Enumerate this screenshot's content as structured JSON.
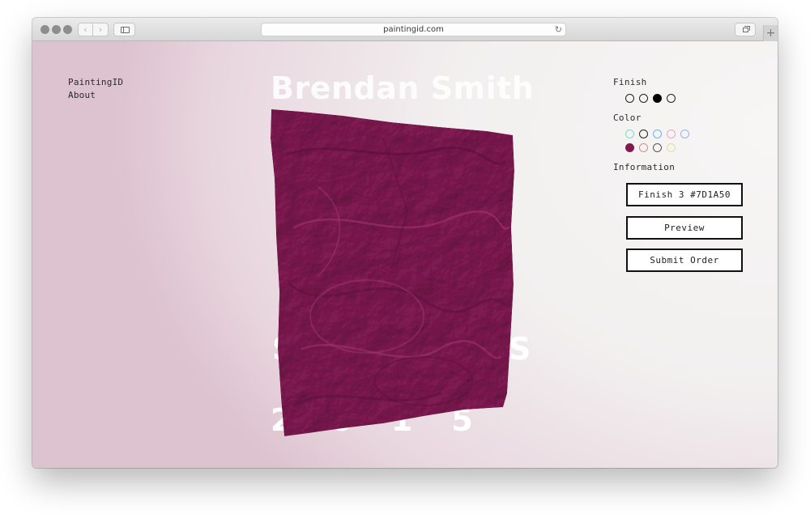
{
  "browser": {
    "url": "paintingid.com",
    "back_glyph": "‹",
    "forward_glyph": "›",
    "reload_glyph": "↻",
    "new_tab_glyph": "+"
  },
  "nav": {
    "items": [
      {
        "label": "PaintingID"
      },
      {
        "label": "About"
      }
    ]
  },
  "hero": {
    "artist": "Brendan Smith",
    "year": "2015",
    "partial_left": "S",
    "partial_right": "S"
  },
  "painting": {
    "color": "#7D1A50",
    "shadow_color": "#5a0f38",
    "highlight_color": "#a5386f"
  },
  "panel": {
    "finish_label": "Finish",
    "finish_options": [
      {
        "fill": "transparent",
        "border": "#222222",
        "selected": false
      },
      {
        "fill": "transparent",
        "border": "#222222",
        "selected": false
      },
      {
        "fill": "#000000",
        "border": "#000000",
        "selected": true
      },
      {
        "fill": "transparent",
        "border": "#222222",
        "selected": false
      }
    ],
    "color_label": "Color",
    "color_options_row1": [
      {
        "border": "#7fd8cf",
        "fill": "transparent"
      },
      {
        "border": "#222222",
        "fill": "transparent"
      },
      {
        "border": "#6fb3e6",
        "fill": "transparent"
      },
      {
        "border": "#e7a9c7",
        "fill": "transparent"
      },
      {
        "border": "#9fb2e8",
        "fill": "transparent"
      }
    ],
    "color_options_row2": [
      {
        "border": "#7D1A50",
        "fill": "#7D1A50"
      },
      {
        "border": "#d98b8b",
        "fill": "transparent"
      },
      {
        "border": "#555555",
        "fill": "transparent"
      },
      {
        "border": "#dde38a",
        "fill": "transparent"
      }
    ],
    "information_label": "Information",
    "info_button_label": "Finish 3 #7D1A50",
    "preview_button_label": "Preview",
    "submit_button_label": "Submit Order"
  }
}
